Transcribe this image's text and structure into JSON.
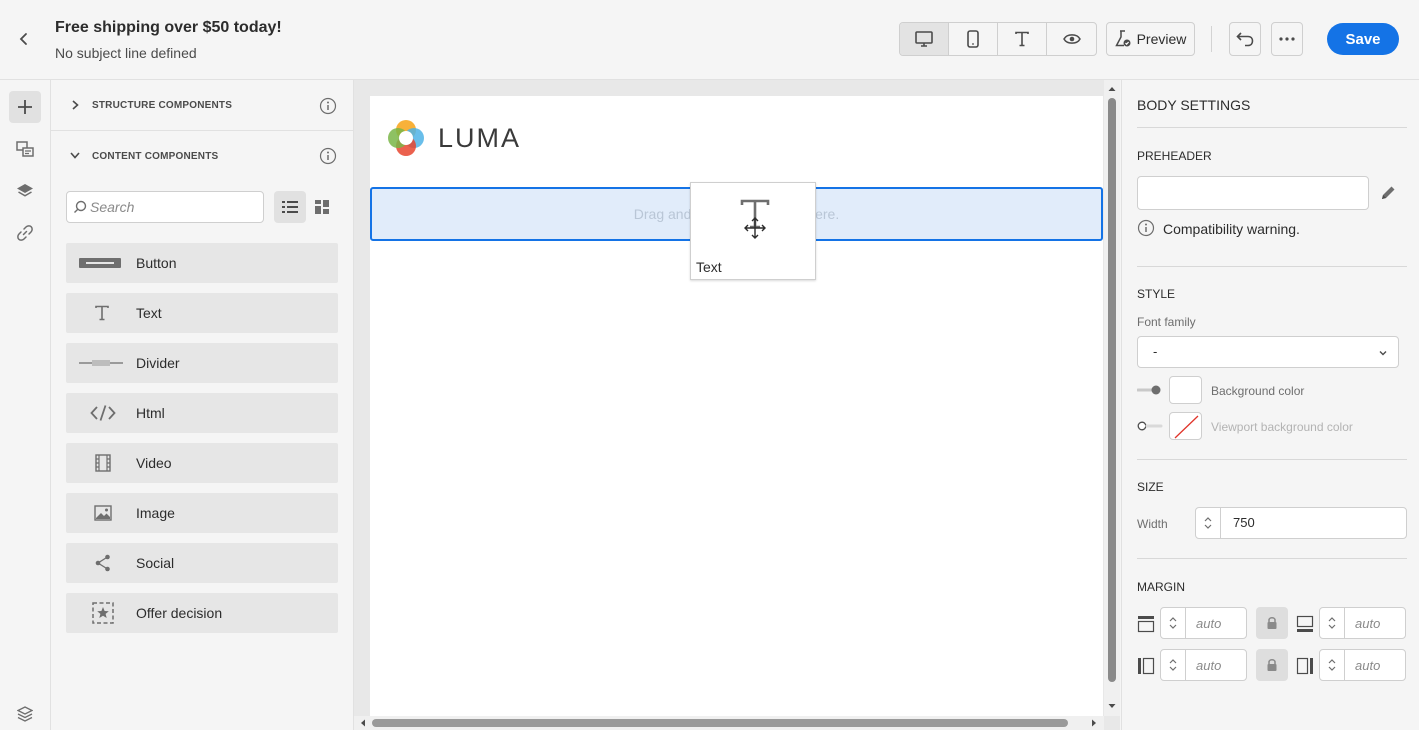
{
  "header": {
    "title": "Free shipping over $50 today!",
    "subtitle": "No subject line defined",
    "preview_label": "Preview",
    "save_label": "Save"
  },
  "panel": {
    "structure_label": "STRUCTURE COMPONENTS",
    "content_label": "CONTENT COMPONENTS",
    "search_placeholder": "Search",
    "components": [
      {
        "label": "Button",
        "icon": "button-icon"
      },
      {
        "label": "Text",
        "icon": "text-icon"
      },
      {
        "label": "Divider",
        "icon": "divider-icon"
      },
      {
        "label": "Html",
        "icon": "html-icon"
      },
      {
        "label": "Video",
        "icon": "video-icon"
      },
      {
        "label": "Image",
        "icon": "image-icon"
      },
      {
        "label": "Social",
        "icon": "social-icon"
      },
      {
        "label": "Offer decision",
        "icon": "offer-decision-icon"
      }
    ]
  },
  "canvas": {
    "logo_text": "LUMA",
    "drop_hint": "Drag and drop components here.",
    "drag_label": "Text"
  },
  "settings": {
    "title": "BODY SETTINGS",
    "preheader_label": "PREHEADER",
    "preheader_value": "",
    "compat_warning": "Compatibility warning.",
    "style_label": "STYLE",
    "font_family_label": "Font family",
    "font_family_value": "-",
    "bg_color_label": "Background color",
    "viewport_bg_label": "Viewport background color",
    "size_label": "SIZE",
    "width_label": "Width",
    "width_value": "750",
    "margin_label": "MARGIN",
    "margin_top": "auto",
    "margin_bottom": "auto",
    "margin_left": "auto",
    "margin_right": "auto"
  },
  "colors": {
    "accent": "#1473e6",
    "drop_zone_bg": "#e1ecfa"
  }
}
